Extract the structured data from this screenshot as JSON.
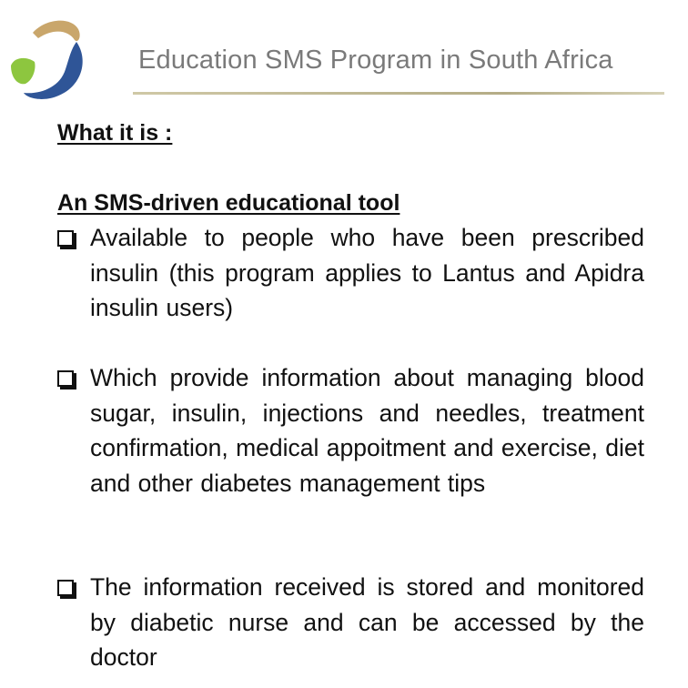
{
  "header": {
    "title": "Education SMS Program in South Africa",
    "logo_colors": {
      "gold": "#c9a66b",
      "blue": "#2f5597",
      "green": "#8dc63f"
    }
  },
  "content": {
    "heading_what": "What it is :",
    "heading_tool": "An SMS-driven educational tool",
    "bullets": [
      {
        "text": "Available to people who have been prescribed insulin (this program applies to Lantus and Apidra insulin users)"
      },
      {
        "text": "Which provide information about managing blood sugar, insulin, injections and needles, treatment confirmation, medical appoitment and exercise, diet and other diabetes management tips"
      },
      {
        "text": "The information received is stored and monitored by diabetic nurse and can be accessed by the doctor"
      }
    ]
  }
}
